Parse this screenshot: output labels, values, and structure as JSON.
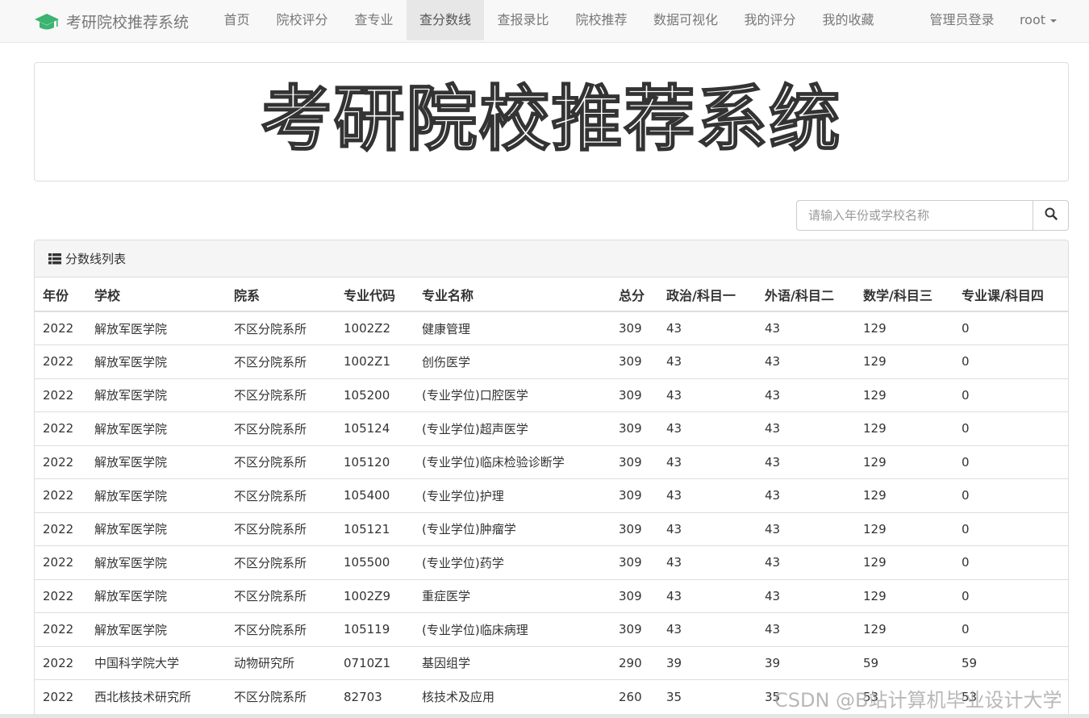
{
  "brand": {
    "title": "考研院校推荐系统",
    "icon": "graduation-cap-icon",
    "icon_color": "#3cb371"
  },
  "nav": {
    "items": [
      "首页",
      "院校评分",
      "查专业",
      "查分数线",
      "查报录比",
      "院校推荐",
      "数据可视化",
      "我的评分",
      "我的收藏"
    ],
    "active": "查分数线",
    "admin_login": "管理员登录",
    "user": "root"
  },
  "banner": {
    "title": "考研院校推荐系统"
  },
  "search": {
    "placeholder": "请输入年份或学校名称",
    "value": ""
  },
  "panel": {
    "heading": "分数线列表",
    "columns": [
      "年份",
      "学校",
      "院系",
      "专业代码",
      "专业名称",
      "总分",
      "政治/科目一",
      "外语/科目二",
      "数学/科目三",
      "专业课/科目四"
    ],
    "rows": [
      [
        "2022",
        "解放军医学院",
        "不区分院系所",
        "1002Z2",
        "健康管理",
        "309",
        "43",
        "43",
        "129",
        "0"
      ],
      [
        "2022",
        "解放军医学院",
        "不区分院系所",
        "1002Z1",
        "创伤医学",
        "309",
        "43",
        "43",
        "129",
        "0"
      ],
      [
        "2022",
        "解放军医学院",
        "不区分院系所",
        "105200",
        "(专业学位)口腔医学",
        "309",
        "43",
        "43",
        "129",
        "0"
      ],
      [
        "2022",
        "解放军医学院",
        "不区分院系所",
        "105124",
        "(专业学位)超声医学",
        "309",
        "43",
        "43",
        "129",
        "0"
      ],
      [
        "2022",
        "解放军医学院",
        "不区分院系所",
        "105120",
        "(专业学位)临床检验诊断学",
        "309",
        "43",
        "43",
        "129",
        "0"
      ],
      [
        "2022",
        "解放军医学院",
        "不区分院系所",
        "105400",
        "(专业学位)护理",
        "309",
        "43",
        "43",
        "129",
        "0"
      ],
      [
        "2022",
        "解放军医学院",
        "不区分院系所",
        "105121",
        "(专业学位)肿瘤学",
        "309",
        "43",
        "43",
        "129",
        "0"
      ],
      [
        "2022",
        "解放军医学院",
        "不区分院系所",
        "105500",
        "(专业学位)药学",
        "309",
        "43",
        "43",
        "129",
        "0"
      ],
      [
        "2022",
        "解放军医学院",
        "不区分院系所",
        "1002Z9",
        "重症医学",
        "309",
        "43",
        "43",
        "129",
        "0"
      ],
      [
        "2022",
        "解放军医学院",
        "不区分院系所",
        "105119",
        "(专业学位)临床病理",
        "309",
        "43",
        "43",
        "129",
        "0"
      ],
      [
        "2022",
        "中国科学院大学",
        "动物研究所",
        "0710Z1",
        "基因组学",
        "290",
        "39",
        "39",
        "59",
        "59"
      ],
      [
        "2022",
        "西北核技术研究所",
        "不区分院系所",
        "82703",
        "核技术及应用",
        "260",
        "35",
        "35",
        "53",
        "53"
      ]
    ]
  },
  "watermark": "CSDN @B站计算机毕业设计大学"
}
